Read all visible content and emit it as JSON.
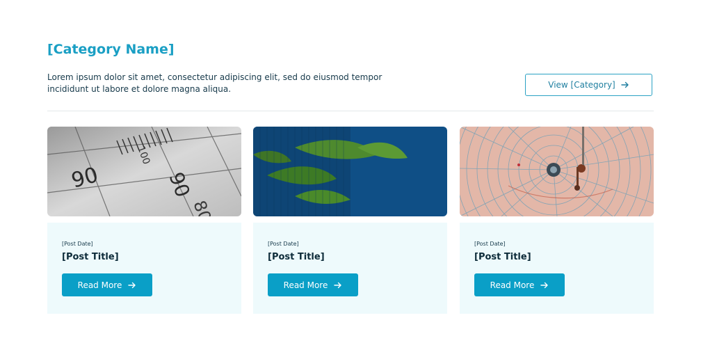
{
  "category": {
    "title": "[Category Name]",
    "description": "Lorem ipsum dolor sit amet, consectetur adipiscing elit, sed do eiusmod tempor incididunt ut labore et dolore magna aliqua.",
    "view_button_label": "View [Category]"
  },
  "posts": [
    {
      "image": "ruler-closeup-image",
      "date": "[Post Date]",
      "title": "[Post Title]",
      "button_label": "Read More"
    },
    {
      "image": "plant-leaves-image",
      "date": "[Post Date]",
      "title": "[Post Title]",
      "button_label": "Read More"
    },
    {
      "image": "chart-recorder-dial-image",
      "date": "[Post Date]",
      "title": "[Post Title]",
      "button_label": "Read More"
    }
  ],
  "colors": {
    "accent": "#1a9fc4",
    "button_bg": "#0a9fc7",
    "card_bg": "#eefafc",
    "text_dark": "#16394a"
  }
}
